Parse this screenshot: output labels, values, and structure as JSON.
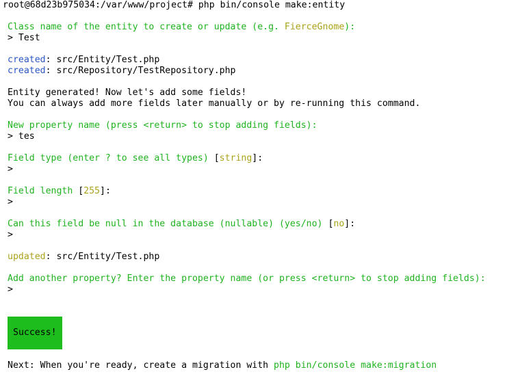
{
  "terminal": {
    "prompt": "root@68d23b975034:/var/www/project# php bin/console make:entity",
    "class_q": {
      "pre": "Class name of the entity to create or update (e.g. ",
      "example": "FierceGnome",
      "post": "):"
    },
    "class_answer": "> Test",
    "created_label": "created",
    "created_files": [
      ": src/Entity/Test.php",
      ": src/Repository/TestRepository.php"
    ],
    "info1": "Entity generated! Now let's add some fields!",
    "info2": "You can always add more fields later manually or by re-running this command.",
    "prop_q": "New property name (press <return> to stop adding fields):",
    "prop_answer": "> tes",
    "type_q": {
      "pre": "Field type (enter ? to see all types) ",
      "lb": "[",
      "default": "string",
      "rb": "]",
      "post": ":"
    },
    "length_q": {
      "pre": "Field length ",
      "lb": "[",
      "default": "255",
      "rb": "]",
      "post": ":"
    },
    "null_q": {
      "pre": "Can this field be null in the database (nullable) (yes/no) ",
      "lb": "[",
      "default": "no",
      "rb": "]",
      "post": ":"
    },
    "empty_answer": ">",
    "updated_label": "updated",
    "updated_file": ": src/Entity/Test.php",
    "another_q": "Add another property? Enter the property name (or press <return> to stop adding fields):",
    "success": "Success!",
    "next_pre": "Next: When you're ready, create a migration with ",
    "next_cmd": "php bin/console make:migration"
  },
  "colors": {
    "background": "#ffffff",
    "text": "#000000",
    "green": "#1fb31f",
    "blue": "#2a56c6",
    "olive": "#aaa21a",
    "success_bg": "#1cbd1c"
  }
}
